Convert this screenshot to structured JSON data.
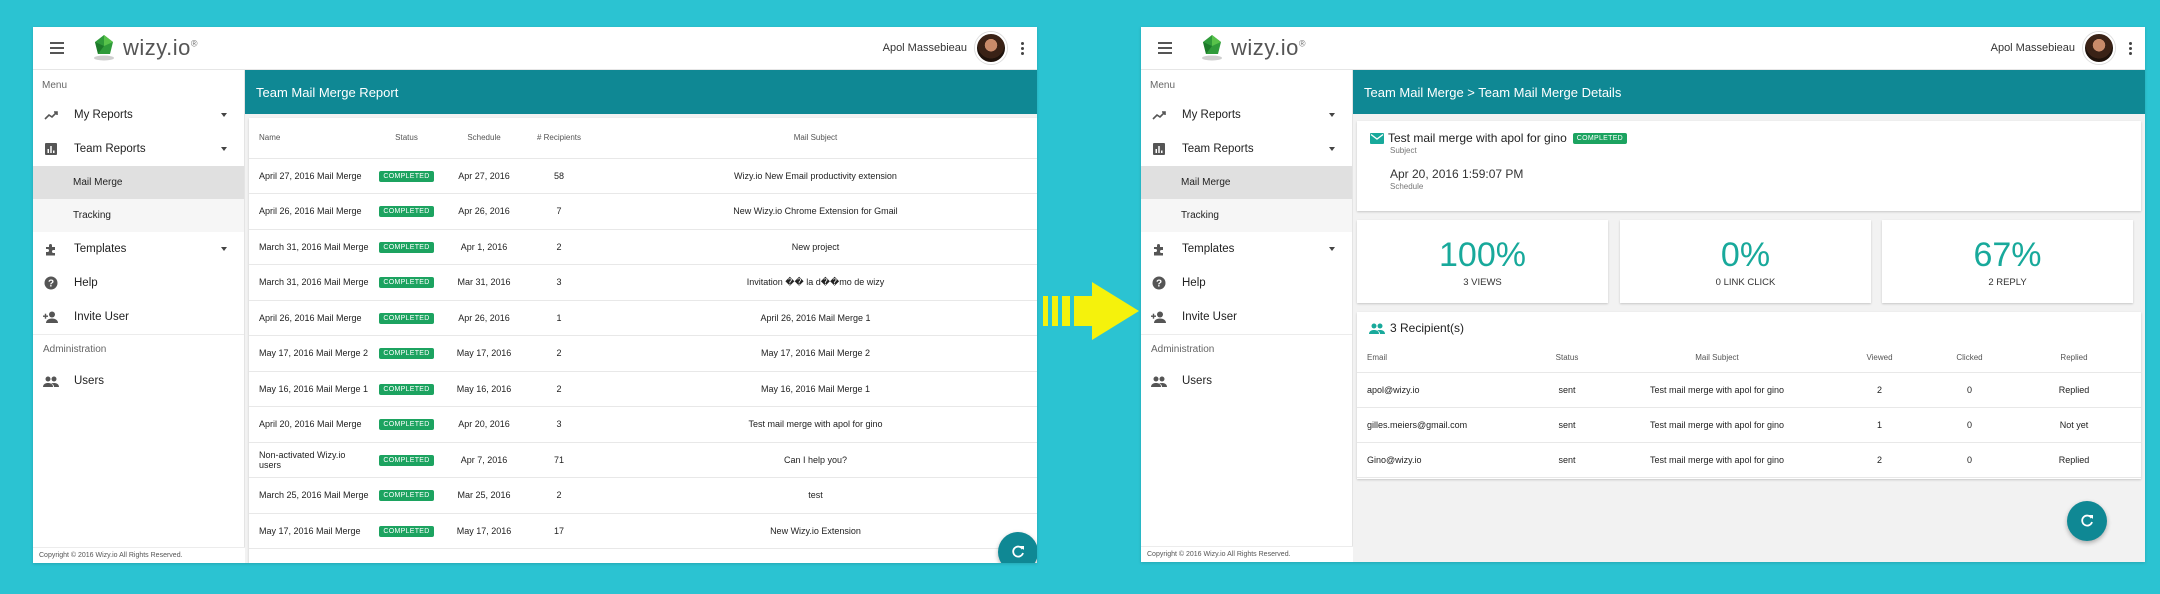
{
  "brand": {
    "name": "wizy.io",
    "sup": "®"
  },
  "user": {
    "name": "Apol Massebieau"
  },
  "sidebar": {
    "menu_heading": "Menu",
    "my_reports": "My Reports",
    "team_reports": "Team Reports",
    "mail_merge": "Mail Merge",
    "tracking": "Tracking",
    "templates": "Templates",
    "help": "Help",
    "invite_user": "Invite User",
    "admin_heading": "Administration",
    "users": "Users"
  },
  "footer": {
    "copyright": "Copyright © 2016 Wizy.io All Rights Reserved."
  },
  "report": {
    "header": "Team Mail Merge Report",
    "columns": {
      "name": "Name",
      "status": "Status",
      "schedule": "Schedule",
      "recipients": "# Recipients",
      "subject": "Mail Subject"
    },
    "rows": [
      {
        "name": "April 27, 2016 Mail Merge",
        "status": "COMPLETED",
        "schedule": "Apr 27, 2016",
        "recipients": "58",
        "subject": "Wizy.io New Email productivity extension"
      },
      {
        "name": "April 26, 2016 Mail Merge",
        "status": "COMPLETED",
        "schedule": "Apr 26, 2016",
        "recipients": "7",
        "subject": "New Wizy.io Chrome Extension for Gmail"
      },
      {
        "name": "March 31, 2016 Mail Merge",
        "status": "COMPLETED",
        "schedule": "Apr 1, 2016",
        "recipients": "2",
        "subject": "New project"
      },
      {
        "name": "March 31, 2016 Mail Merge",
        "status": "COMPLETED",
        "schedule": "Mar 31, 2016",
        "recipients": "3",
        "subject": "Invitation �� la d��mo de wizy"
      },
      {
        "name": "April 26, 2016 Mail Merge",
        "status": "COMPLETED",
        "schedule": "Apr 26, 2016",
        "recipients": "1",
        "subject": "April 26, 2016 Mail Merge 1"
      },
      {
        "name": "May 17, 2016 Mail Merge 2",
        "status": "COMPLETED",
        "schedule": "May 17, 2016",
        "recipients": "2",
        "subject": "May 17, 2016 Mail Merge 2"
      },
      {
        "name": "May 16, 2016 Mail Merge 1",
        "status": "COMPLETED",
        "schedule": "May 16, 2016",
        "recipients": "2",
        "subject": "May 16, 2016 Mail Merge 1"
      },
      {
        "name": "April 20, 2016 Mail Merge",
        "status": "COMPLETED",
        "schedule": "Apr 20, 2016",
        "recipients": "3",
        "subject": "Test mail merge with apol for gino"
      },
      {
        "name": "Non-activated Wizy.io users",
        "status": "COMPLETED",
        "schedule": "Apr 7, 2016",
        "recipients": "71",
        "subject": "Can I help you?"
      },
      {
        "name": "March 25, 2016 Mail Merge",
        "status": "COMPLETED",
        "schedule": "Mar 25, 2016",
        "recipients": "2",
        "subject": "test"
      },
      {
        "name": "May 17, 2016 Mail Merge",
        "status": "COMPLETED",
        "schedule": "May 17, 2016",
        "recipients": "17",
        "subject": "New Wizy.io Extension"
      }
    ]
  },
  "details": {
    "header": "Team Mail Merge > Team Mail Merge Details",
    "subject": "Test mail merge with apol for gino",
    "status": "COMPLETED",
    "subject_label": "Subject",
    "schedule": "Apr 20, 2016 1:59:07 PM",
    "schedule_label": "Schedule",
    "stats": [
      {
        "value": "100%",
        "label": "3 VIEWS"
      },
      {
        "value": "0%",
        "label": "0 LINK CLICK"
      },
      {
        "value": "67%",
        "label": "2 REPLY"
      }
    ],
    "recipients_title": "3 Recipient(s)",
    "columns": {
      "email": "Email",
      "status": "Status",
      "subject": "Mail Subject",
      "viewed": "Viewed",
      "clicked": "Clicked",
      "replied": "Replied"
    },
    "rows": [
      {
        "email": "apol@wizy.io",
        "status": "sent",
        "subject": "Test mail merge with apol for gino",
        "viewed": "2",
        "clicked": "0",
        "replied": "Replied"
      },
      {
        "email": "gilles.meiers@gmail.com",
        "status": "sent",
        "subject": "Test mail merge with apol for gino",
        "viewed": "1",
        "clicked": "0",
        "replied": "Not yet"
      },
      {
        "email": "Gino@wizy.io",
        "status": "sent",
        "subject": "Test mail merge with apol for gino",
        "viewed": "2",
        "clicked": "0",
        "replied": "Replied"
      }
    ]
  },
  "colors": {
    "background": "#2bc3d2",
    "teal": "#0f8894",
    "badge_green": "#1ca360",
    "stat_teal": "#18a99b",
    "arrow_yellow": "#f5f20c"
  },
  "icons": [
    "menu-icon",
    "wizy-logo-icon",
    "more-vert-icon",
    "trending-up-icon",
    "bar-chart-icon",
    "puzzle-icon",
    "help-icon",
    "person-add-icon",
    "people-icon",
    "refresh-icon",
    "email-icon",
    "arrow-right-icon"
  ]
}
